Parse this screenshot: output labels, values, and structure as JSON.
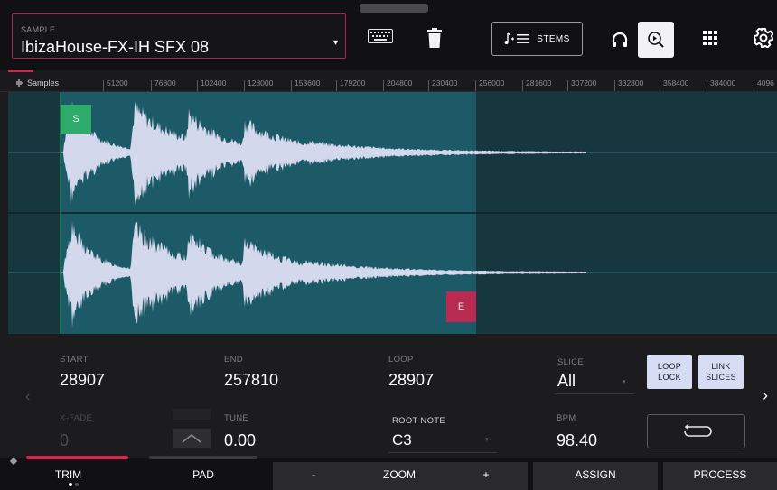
{
  "header": {
    "sample_label": "SAMPLE",
    "sample_name": "IbizaHouse-FX-IH SFX 08",
    "stems_label": "STEMS"
  },
  "ruler": {
    "label": "Samples",
    "ticks": [
      "51200",
      "76800",
      "102400",
      "128000",
      "153600",
      "179200",
      "204800",
      "230400",
      "256000",
      "281600",
      "307200",
      "332800",
      "358400",
      "384000",
      "4096"
    ]
  },
  "markers": {
    "start": "S",
    "end": "E"
  },
  "params": {
    "start": {
      "label": "START",
      "value": "28907"
    },
    "end": {
      "label": "END",
      "value": "257810"
    },
    "loop": {
      "label": "LOOP",
      "value": "28907"
    },
    "slice": {
      "label": "SLICE",
      "value": "All"
    },
    "xfade": {
      "label": "X-FADE",
      "value": "0"
    },
    "tune": {
      "label": "TUNE",
      "value": "0.00"
    },
    "root_note": {
      "label": "ROOT NOTE",
      "value": "C3"
    },
    "bpm": {
      "label": "BPM",
      "value": "98.40"
    },
    "loop_lock": {
      "line1": "LOOP",
      "line2": "LOCK"
    },
    "link_slices": {
      "line1": "LINK",
      "line2": "SLICES"
    }
  },
  "bottom": {
    "trim": "TRIM",
    "pad": "PAD",
    "zoom_minus": "-",
    "zoom": "ZOOM",
    "zoom_plus": "+",
    "assign": "ASSIGN",
    "process": "PROCESS"
  },
  "colors": {
    "accent": "#d8234f",
    "waveform_bg": "#16373e",
    "selected_region": "#1b5a66",
    "start_marker": "#2eaa6a",
    "end_marker": "#b82a50",
    "waveform": "#d4d8ec"
  },
  "icons": [
    "keyboard-icon",
    "trash-icon",
    "stems-icon",
    "headphones-icon",
    "zoom-play-icon",
    "grid-icon",
    "gear-icon",
    "loop-icon",
    "xfade-icon",
    "chevron-left-icon",
    "chevron-right-icon"
  ]
}
